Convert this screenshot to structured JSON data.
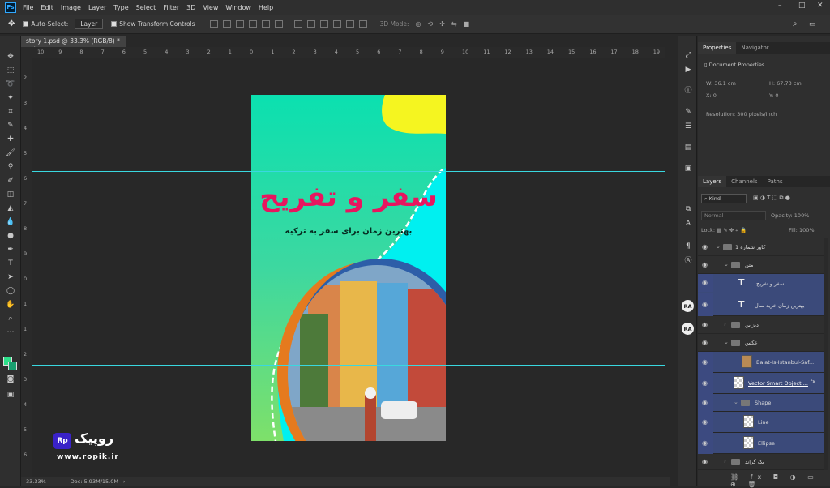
{
  "app": {
    "logo": "Ps"
  },
  "menus": [
    "File",
    "Edit",
    "Image",
    "Layer",
    "Type",
    "Select",
    "Filter",
    "3D",
    "View",
    "Window",
    "Help"
  ],
  "options": {
    "auto_select_label": "Auto-Select:",
    "auto_select_value": "Layer",
    "transform_controls_label": "Show Transform Controls",
    "mode_3d_label": "3D Mode:"
  },
  "document": {
    "tab_label": "story 1.psd @ 33.3% (RGB/8) *",
    "tab_close": "×"
  },
  "ruler_top": [
    "10",
    "9",
    "8",
    "7",
    "6",
    "5",
    "4",
    "3",
    "2",
    "1",
    "0",
    "1",
    "2",
    "3",
    "4",
    "5",
    "6",
    "7",
    "8",
    "9",
    "10",
    "11",
    "12",
    "13",
    "14",
    "15",
    "16",
    "17",
    "18",
    "19"
  ],
  "ruler_left": [
    "2",
    "3",
    "4",
    "5",
    "6",
    "7",
    "8",
    "9",
    "0",
    "1",
    "1",
    "2",
    "3",
    "4",
    "5",
    "6"
  ],
  "artwork": {
    "title": "سفر و تفریح",
    "subtitle": "بهترین زمان برای سفر به ترکیه"
  },
  "status": {
    "zoom": "33.33%",
    "doc_info": "Doc: 5.93M/15.0M"
  },
  "properties": {
    "tabs": [
      "Properties",
      "Navigator"
    ],
    "header": "Document Properties",
    "width_label": "W:",
    "width": "36.1 cm",
    "height_label": "H:",
    "height": "67.73 cm",
    "x_label": "X:",
    "x": "0",
    "y_label": "Y:",
    "y": "0",
    "resolution": "Resolution: 300 pixels/inch"
  },
  "layers_panel": {
    "tabs": [
      "Layers",
      "Channels",
      "Paths"
    ],
    "kind": "Kind",
    "blend": "Normal",
    "opacity_label": "Opacity:",
    "opacity": "100%",
    "lock_label": "Lock:",
    "fill_label": "Fill:",
    "fill": "100%",
    "layers": [
      {
        "name": "کاور شماره 1",
        "type": "group"
      },
      {
        "name": "متن",
        "type": "group"
      },
      {
        "name": "سفر و تفریح",
        "type": "text"
      },
      {
        "name": "بهترین زمان خرید سال",
        "type": "text"
      },
      {
        "name": "دیزاین",
        "type": "group"
      },
      {
        "name": "عکس",
        "type": "group"
      },
      {
        "name": "Balat-Is-Istanbul-Saf...",
        "type": "image"
      },
      {
        "name": "Vector Smart Object ...",
        "type": "smart"
      },
      {
        "name": "Shape",
        "type": "group"
      },
      {
        "name": "Line",
        "type": "shape"
      },
      {
        "name": "Ellipse",
        "type": "shape"
      },
      {
        "name": "بک گراند",
        "type": "group"
      }
    ],
    "fx": "fx"
  },
  "watermark": {
    "badge": "Rp",
    "word": "روپیک",
    "site": "www.ropik.ir"
  },
  "colors": {
    "accent": "#e8155f",
    "teal": "#00f0f0",
    "yellow": "#f5f520",
    "selection": "#3b4a7a"
  }
}
